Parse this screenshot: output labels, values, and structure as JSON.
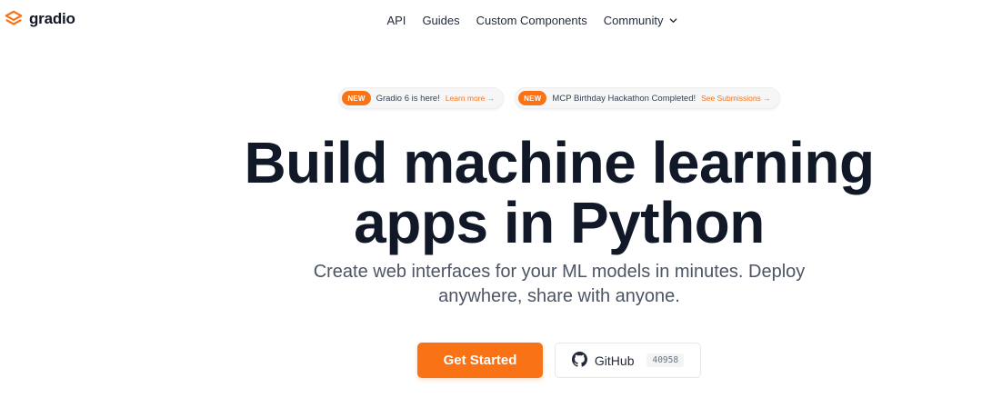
{
  "brand": {
    "name": "gradio",
    "accent": "#f97316"
  },
  "nav": {
    "items": [
      {
        "label": "API"
      },
      {
        "label": "Guides"
      },
      {
        "label": "Custom Components"
      },
      {
        "label": "Community"
      }
    ]
  },
  "announcements": [
    {
      "badge": "NEW",
      "text": "Gradio 6 is here!",
      "link": "Learn more →"
    },
    {
      "badge": "NEW",
      "text": "MCP Birthday Hackathon Completed!",
      "link": "See Submissions →"
    }
  ],
  "hero": {
    "title_line1": "Build machine learning",
    "title_line2": "apps in Python",
    "subtitle_line1": "Create web interfaces for your ML models in minutes. Deploy",
    "subtitle_line2": "anywhere, share with anyone."
  },
  "cta": {
    "primary_label": "Get Started",
    "github_label": "GitHub",
    "github_stars": "40958"
  },
  "icons": {
    "logo": "gradio-logo-icon",
    "dropdown": "chevron-down-icon",
    "github": "github-icon"
  }
}
